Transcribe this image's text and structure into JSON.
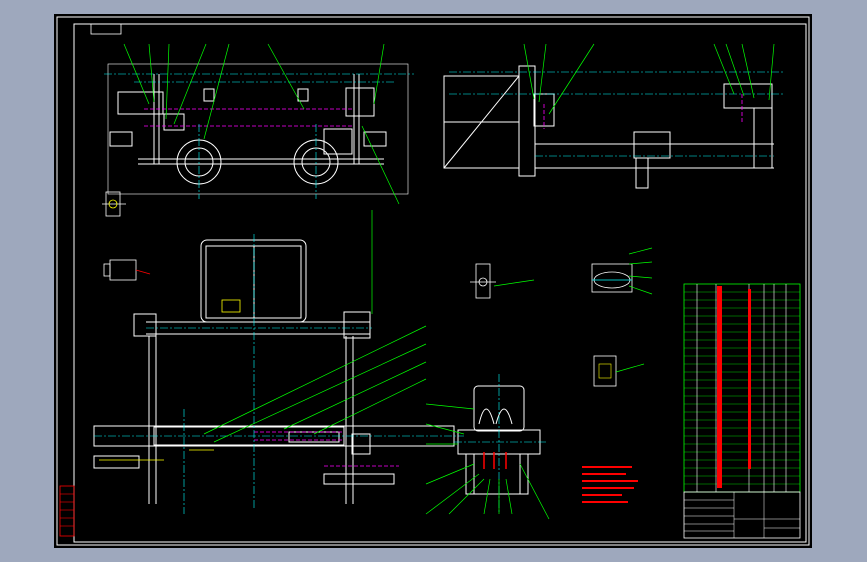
{
  "window": {
    "title": ""
  },
  "sheet": {
    "stamp_top_left": "",
    "drawing_colors": {
      "frame": "#ffffff",
      "geometry": "#ffffff",
      "centerline": "#00ffff",
      "hidden": "#ff00ff",
      "leader": "#00ff00",
      "dimension": "#ffff00",
      "notes": "#ff0000",
      "table": "#00ff00"
    }
  },
  "notes": {
    "title": "",
    "lines": [
      "",
      "",
      "",
      "",
      "",
      ""
    ]
  },
  "bom": {
    "rows": 26
  },
  "title_block": {
    "name": "",
    "drawing_no": "",
    "scale": ""
  }
}
